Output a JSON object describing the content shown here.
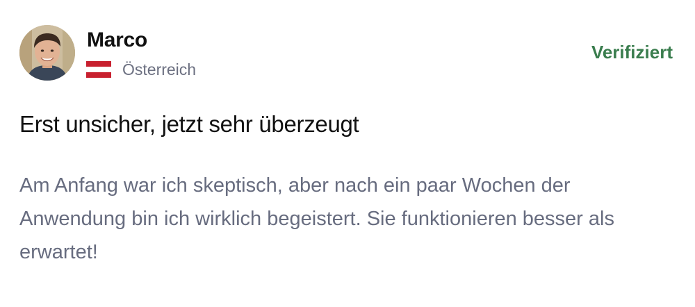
{
  "reviewer": {
    "name": "Marco",
    "country": "Österreich",
    "flag_icon": "austria-flag-icon",
    "avatar_icon": "avatar-photo"
  },
  "badge": {
    "label": "Verifiziert",
    "color": "#3a7d4e"
  },
  "review": {
    "title": "Erst unsicher, jetzt sehr überzeugt",
    "body": "Am Anfang war ich skeptisch, aber nach ein paar Wochen der Anwendung bin ich wirklich begeistert. Sie funktionieren besser als erwartet!"
  },
  "colors": {
    "text_primary": "#111111",
    "text_secondary": "#676c7f",
    "flag_red": "#c8202f"
  }
}
